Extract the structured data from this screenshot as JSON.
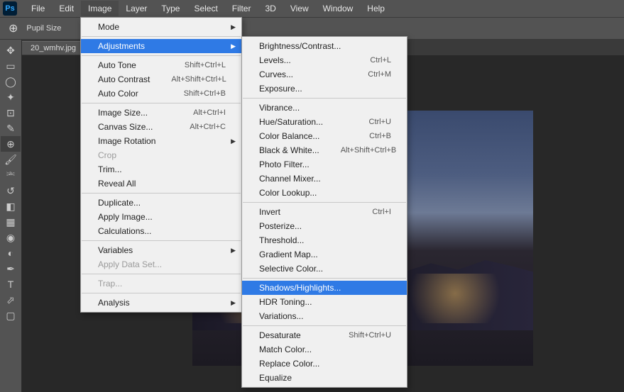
{
  "app": {
    "logo": "Ps"
  },
  "menubar": [
    "File",
    "Edit",
    "Image",
    "Layer",
    "Type",
    "Select",
    "Filter",
    "3D",
    "View",
    "Window",
    "Help"
  ],
  "optionsbar": {
    "label": "Pupil Size"
  },
  "doc_tab": {
    "name": "20_wmhv.jpg"
  },
  "image_menu": {
    "mode": "Mode",
    "adjustments": "Adjustments",
    "auto_tone": {
      "label": "Auto Tone",
      "shortcut": "Shift+Ctrl+L"
    },
    "auto_contrast": {
      "label": "Auto Contrast",
      "shortcut": "Alt+Shift+Ctrl+L"
    },
    "auto_color": {
      "label": "Auto Color",
      "shortcut": "Shift+Ctrl+B"
    },
    "image_size": {
      "label": "Image Size...",
      "shortcut": "Alt+Ctrl+I"
    },
    "canvas_size": {
      "label": "Canvas Size...",
      "shortcut": "Alt+Ctrl+C"
    },
    "image_rotation": "Image Rotation",
    "crop": "Crop",
    "trim": "Trim...",
    "reveal_all": "Reveal All",
    "duplicate": "Duplicate...",
    "apply_image": "Apply Image...",
    "calculations": "Calculations...",
    "variables": "Variables",
    "apply_data_set": "Apply Data Set...",
    "trap": "Trap...",
    "analysis": "Analysis"
  },
  "adjust_menu": {
    "brightness": "Brightness/Contrast...",
    "levels": {
      "label": "Levels...",
      "shortcut": "Ctrl+L"
    },
    "curves": {
      "label": "Curves...",
      "shortcut": "Ctrl+M"
    },
    "exposure": "Exposure...",
    "vibrance": "Vibrance...",
    "hue_sat": {
      "label": "Hue/Saturation...",
      "shortcut": "Ctrl+U"
    },
    "color_balance": {
      "label": "Color Balance...",
      "shortcut": "Ctrl+B"
    },
    "black_white": {
      "label": "Black & White...",
      "shortcut": "Alt+Shift+Ctrl+B"
    },
    "photo_filter": "Photo Filter...",
    "channel_mixer": "Channel Mixer...",
    "color_lookup": "Color Lookup...",
    "invert": {
      "label": "Invert",
      "shortcut": "Ctrl+I"
    },
    "posterize": "Posterize...",
    "threshold": "Threshold...",
    "gradient_map": "Gradient Map...",
    "selective_color": "Selective Color...",
    "shadows_highlights": "Shadows/Highlights...",
    "hdr_toning": "HDR Toning...",
    "variations": "Variations...",
    "desaturate": {
      "label": "Desaturate",
      "shortcut": "Shift+Ctrl+U"
    },
    "match_color": "Match Color...",
    "replace_color": "Replace Color...",
    "equalize": "Equalize"
  }
}
